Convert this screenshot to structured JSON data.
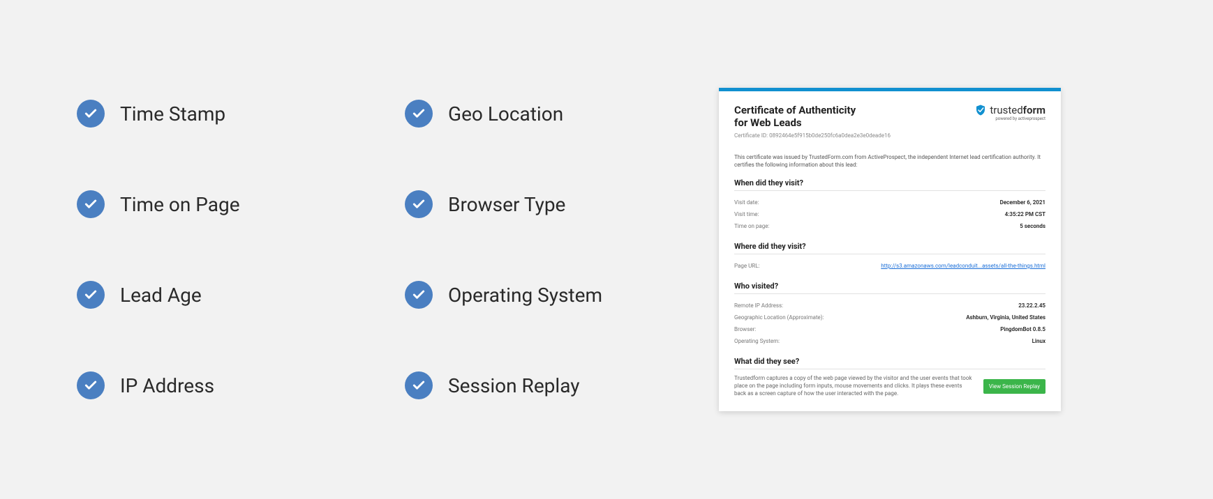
{
  "features": {
    "col1": [
      "Time Stamp",
      "Time on Page",
      "Lead Age",
      "IP Address"
    ],
    "col2": [
      "Geo Location",
      "Browser Type",
      "Operating System",
      "Session Replay"
    ]
  },
  "certificate": {
    "title_line1": "Certificate of Authenticity",
    "title_line2": "for Web Leads",
    "id_label": "Certificate ID: 0892464e5f915b0de250fc6a0dea2e3e0deade16",
    "brand_trusted": "trusted",
    "brand_form": "form",
    "brand_sub": "powered by activeprospect",
    "intro": "This certificate was issued by TrustedForm.com from ActiveProspect, the independent Internet lead certification authority. It certifies the following information about this lead:",
    "sections": {
      "when": {
        "heading": "When did they visit?",
        "rows": [
          {
            "k": "Visit date:",
            "v": "December 6, 2021"
          },
          {
            "k": "Visit time:",
            "v": "4:35:22 PM CST"
          },
          {
            "k": "Time on page:",
            "v": "5 seconds"
          }
        ]
      },
      "where": {
        "heading": "Where did they visit?",
        "rows": [
          {
            "k": "Page URL:",
            "v": "http://s3.amazonaws.com/leadconduit...assets/all-the-things.html",
            "link": true
          }
        ]
      },
      "who": {
        "heading": "Who visited?",
        "rows": [
          {
            "k": "Remote IP Address:",
            "v": "23.22.2.45"
          },
          {
            "k": "Geographic Location (Approximate):",
            "v": "Ashburn, Virginia, United States"
          },
          {
            "k": "Browser:",
            "v": "PingdomBot 0.8.5"
          },
          {
            "k": "Operating System:",
            "v": "Linux"
          }
        ]
      },
      "what": {
        "heading": "What did they see?",
        "text": "Trustedform captures a copy of the web page viewed by the visitor and the user events that took place on the page including form inputs, mouse movements and clicks. It plays these events back as a screen capture of how the user interacted with the page.",
        "button": "View Session Replay"
      }
    }
  }
}
